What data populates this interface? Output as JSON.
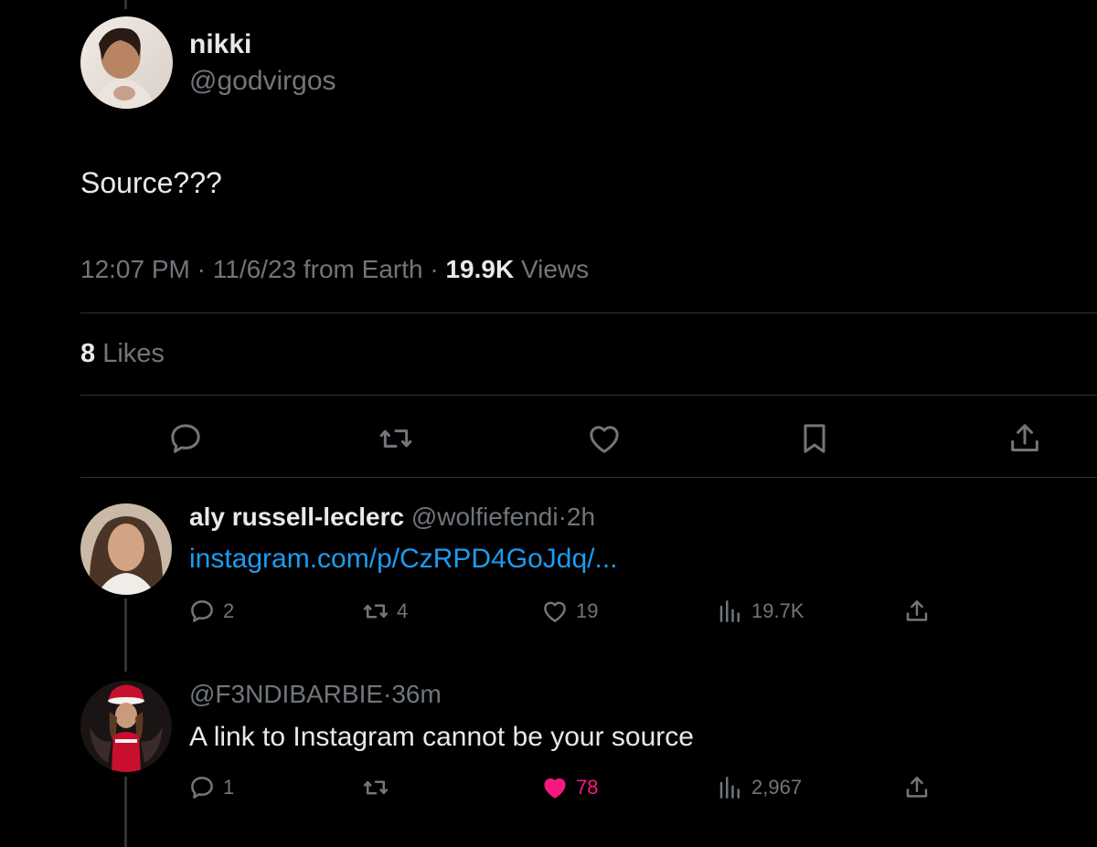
{
  "main_tweet": {
    "display_name": "nikki",
    "handle": "@godvirgos",
    "text": "Source???",
    "time": "12:07 PM",
    "sep1": "·",
    "date_location": "11/6/23 from Earth",
    "sep2": "·",
    "views_count": "19.9K",
    "views_label": "Views",
    "likes_count": "8",
    "likes_label": "Likes"
  },
  "actions": [
    "reply-icon",
    "retweet-icon",
    "like-icon",
    "bookmark-icon",
    "share-icon"
  ],
  "replies": [
    {
      "display_name": "aly russell-leclerc",
      "handle": "@wolfiefendi",
      "sep": "·",
      "time": "2h",
      "link": "instagram.com/p/CzRPD4GoJdq/...",
      "reply_count": "2",
      "retweet_count": "4",
      "like_count": "19",
      "view_count": "19.7K"
    },
    {
      "handle": "@F3NDIBARBIE",
      "sep": "·",
      "time": "36m",
      "text": "A link to Instagram cannot be your source",
      "reply_count": "1",
      "retweet_count": "",
      "like_count": "78",
      "view_count": "2,967"
    }
  ],
  "colors": {
    "background": "#000000",
    "text_primary": "#e7e9ea",
    "text_secondary": "#71767b",
    "link": "#1d9bf0",
    "like_active": "#f91880",
    "divider": "#2f3336"
  }
}
